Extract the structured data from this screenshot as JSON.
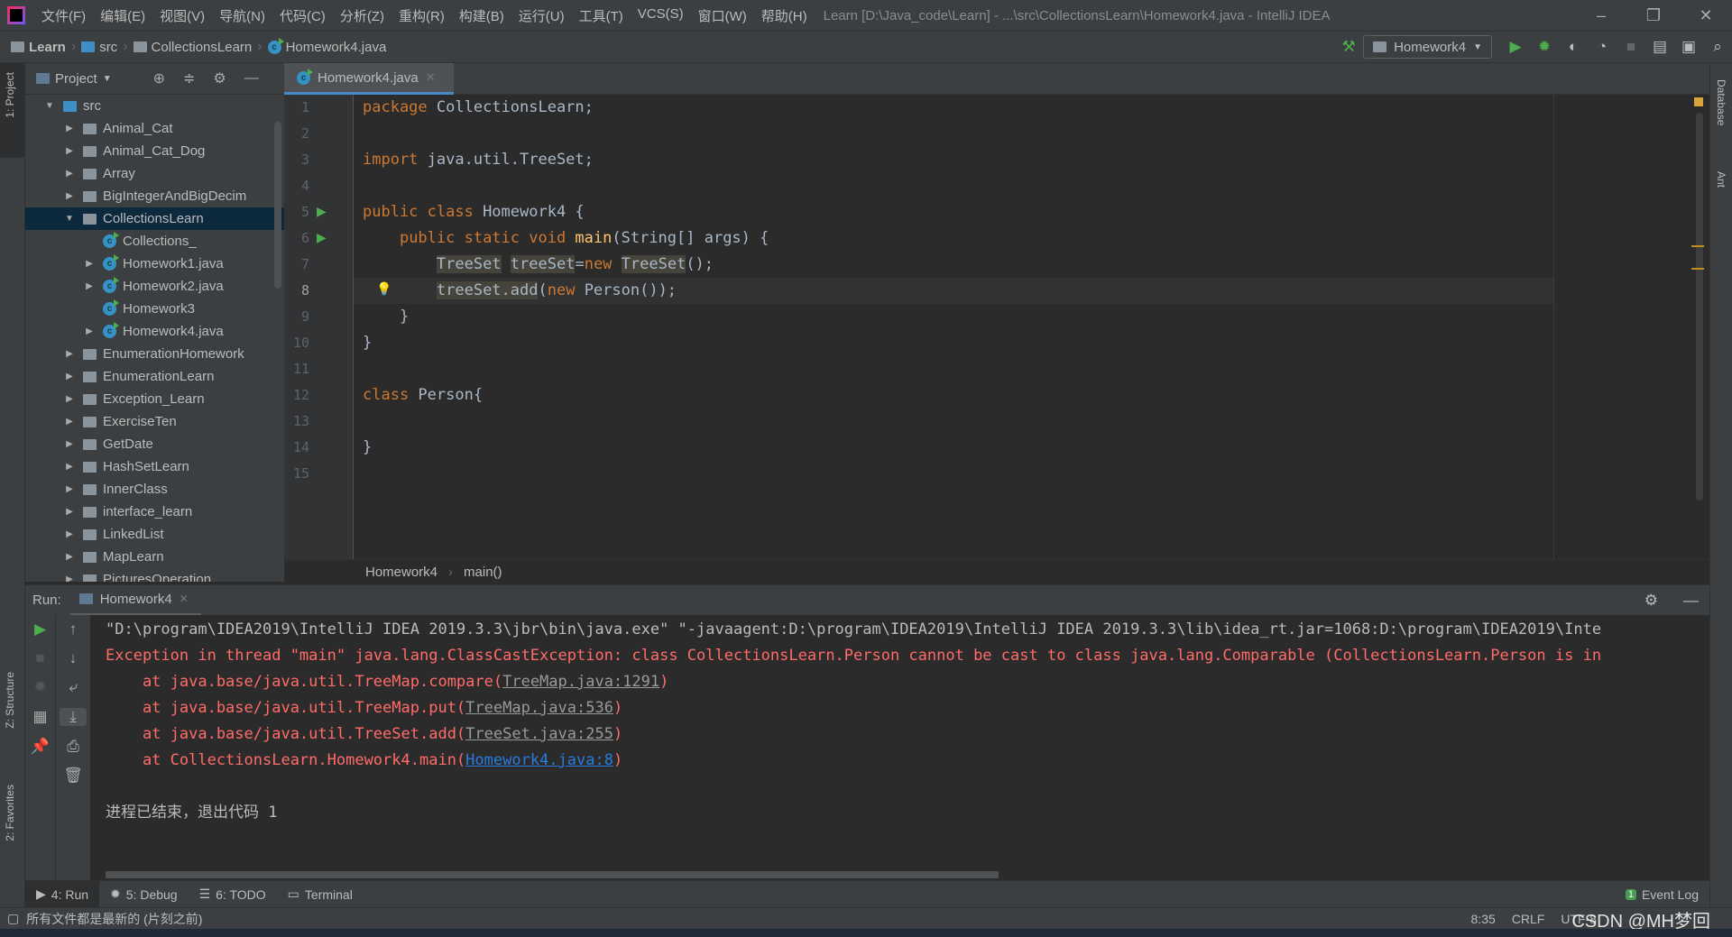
{
  "menu": [
    "文件(F)",
    "编辑(E)",
    "视图(V)",
    "导航(N)",
    "代码(C)",
    "分析(Z)",
    "重构(R)",
    "构建(B)",
    "运行(U)",
    "工具(T)",
    "VCS(S)",
    "窗口(W)",
    "帮助(H)"
  ],
  "window_title": "Learn [D:\\Java_code\\Learn] - ...\\src\\CollectionsLearn\\Homework4.java - IntelliJ IDEA",
  "breadcrumb": [
    "Learn",
    "src",
    "CollectionsLearn",
    "Homework4.java"
  ],
  "run_config": "Homework4",
  "left_strip": {
    "project": "1: Project",
    "structure": "Z: Structure",
    "favorites": "2: Favorites"
  },
  "right_strip": {
    "database": "Database",
    "ant": "Ant"
  },
  "project_panel": {
    "title": "Project"
  },
  "tree": [
    {
      "label": "src",
      "level": 0,
      "expanded": true,
      "type": "src"
    },
    {
      "label": "Animal_Cat",
      "level": 1,
      "type": "package"
    },
    {
      "label": "Animal_Cat_Dog",
      "level": 1,
      "type": "package"
    },
    {
      "label": "Array",
      "level": 1,
      "type": "package"
    },
    {
      "label": "BigIntegerAndBigDecim",
      "level": 1,
      "type": "package"
    },
    {
      "label": "CollectionsLearn",
      "level": 1,
      "expanded": true,
      "selected": true,
      "type": "package"
    },
    {
      "label": "Collections_",
      "level": 2,
      "type": "class",
      "leaf": true
    },
    {
      "label": "Homework1.java",
      "level": 2,
      "type": "class"
    },
    {
      "label": "Homework2.java",
      "level": 2,
      "type": "class"
    },
    {
      "label": "Homework3",
      "level": 2,
      "type": "class",
      "leaf": true
    },
    {
      "label": "Homework4.java",
      "level": 2,
      "type": "class"
    },
    {
      "label": "EnumerationHomework",
      "level": 1,
      "type": "package"
    },
    {
      "label": "EnumerationLearn",
      "level": 1,
      "type": "package"
    },
    {
      "label": "Exception_Learn",
      "level": 1,
      "type": "package"
    },
    {
      "label": "ExerciseTen",
      "level": 1,
      "type": "package"
    },
    {
      "label": "GetDate",
      "level": 1,
      "type": "package"
    },
    {
      "label": "HashSetLearn",
      "level": 1,
      "type": "package"
    },
    {
      "label": "InnerClass",
      "level": 1,
      "type": "package"
    },
    {
      "label": "interface_learn",
      "level": 1,
      "type": "package"
    },
    {
      "label": "LinkedList",
      "level": 1,
      "type": "package"
    },
    {
      "label": "MapLearn",
      "level": 1,
      "type": "package"
    },
    {
      "label": "PicturesOperation",
      "level": 1,
      "type": "package"
    }
  ],
  "editor_tab": "Homework4.java",
  "code": [
    [
      [
        "k",
        "package "
      ],
      [
        "",
        "CollectionsLearn;"
      ]
    ],
    [],
    [
      [
        "k",
        "import "
      ],
      [
        "",
        "java.util.TreeSet;"
      ]
    ],
    [],
    [
      [
        "k",
        "public class "
      ],
      [
        "",
        "Homework4 {"
      ]
    ],
    [
      [
        "",
        "    "
      ],
      [
        "k",
        "public static void "
      ],
      [
        "f",
        "main"
      ],
      [
        "",
        "(String[] args) {"
      ]
    ],
    [
      [
        "",
        "        "
      ],
      [
        "hl",
        "TreeSet"
      ],
      [
        "",
        " "
      ],
      [
        "hl",
        "treeSet"
      ],
      [
        "",
        "="
      ],
      [
        "k",
        "new "
      ],
      [
        "hl",
        "TreeSet"
      ],
      [
        "",
        "();"
      ]
    ],
    [
      [
        "",
        "        "
      ],
      [
        "hl",
        "treeSet.add"
      ],
      [
        "",
        "("
      ],
      [
        "k",
        "new "
      ],
      [
        "",
        "Person());"
      ]
    ],
    [
      [
        "",
        "    }"
      ]
    ],
    [
      [
        "",
        "}"
      ]
    ],
    [],
    [
      [
        "k",
        "class "
      ],
      [
        "",
        "Person{"
      ]
    ],
    [],
    [
      [
        "",
        "}"
      ]
    ],
    []
  ],
  "current_line": 8,
  "editor_breadcrumb": [
    "Homework4",
    "main()"
  ],
  "run": {
    "label": "Run:",
    "tab": "Homework4"
  },
  "console": [
    {
      "style": "plain",
      "parts": [
        [
          "plain",
          "\"D:\\program\\IDEA2019\\IntelliJ IDEA 2019.3.3\\jbr\\bin\\java.exe\" \"-javaagent:D:\\program\\IDEA2019\\IntelliJ IDEA 2019.3.3\\lib\\idea_rt.jar=1068:D:\\program\\IDEA2019\\Inte"
        ]
      ]
    },
    {
      "parts": [
        [
          "err",
          "Exception in thread \"main\" java.lang.ClassCastException: class CollectionsLearn.Person cannot be cast to class java.lang.Comparable (CollectionsLearn.Person is in"
        ]
      ]
    },
    {
      "parts": [
        [
          "err",
          "    at java.base/java.util.TreeMap.compare("
        ],
        [
          "lk",
          "TreeMap.java:1291"
        ],
        [
          "err",
          ")"
        ]
      ]
    },
    {
      "parts": [
        [
          "err",
          "    at java.base/java.util.TreeMap.put("
        ],
        [
          "lk",
          "TreeMap.java:536"
        ],
        [
          "err",
          ")"
        ]
      ]
    },
    {
      "parts": [
        [
          "err",
          "    at java.base/java.util.TreeSet.add("
        ],
        [
          "lk",
          "TreeSet.java:255"
        ],
        [
          "err",
          ")"
        ]
      ]
    },
    {
      "parts": [
        [
          "err",
          "    at CollectionsLearn.Homework4.main("
        ],
        [
          "lkb",
          "Homework4.java:8"
        ],
        [
          "err",
          ")"
        ]
      ]
    },
    {
      "parts": []
    },
    {
      "parts": [
        [
          "plain",
          "进程已结束，退出代码 1"
        ]
      ]
    }
  ],
  "bottom_tabs": [
    "4: Run",
    "5: Debug",
    "6: TODO",
    "Terminal"
  ],
  "event_log": {
    "label": "Event Log",
    "count": "1"
  },
  "status": {
    "message": "所有文件都是最新的 (片刻之前)",
    "position": "8:35",
    "line_sep": "CRLF",
    "encoding": "UTF-8"
  },
  "watermark": "CSDN @MH梦回",
  "colors": {
    "keyword": "#cc7832",
    "method": "#ffc66d",
    "error": "#ff6b68",
    "link": "#287bde",
    "selection": "#0d293e",
    "accent": "#4a88c7"
  }
}
